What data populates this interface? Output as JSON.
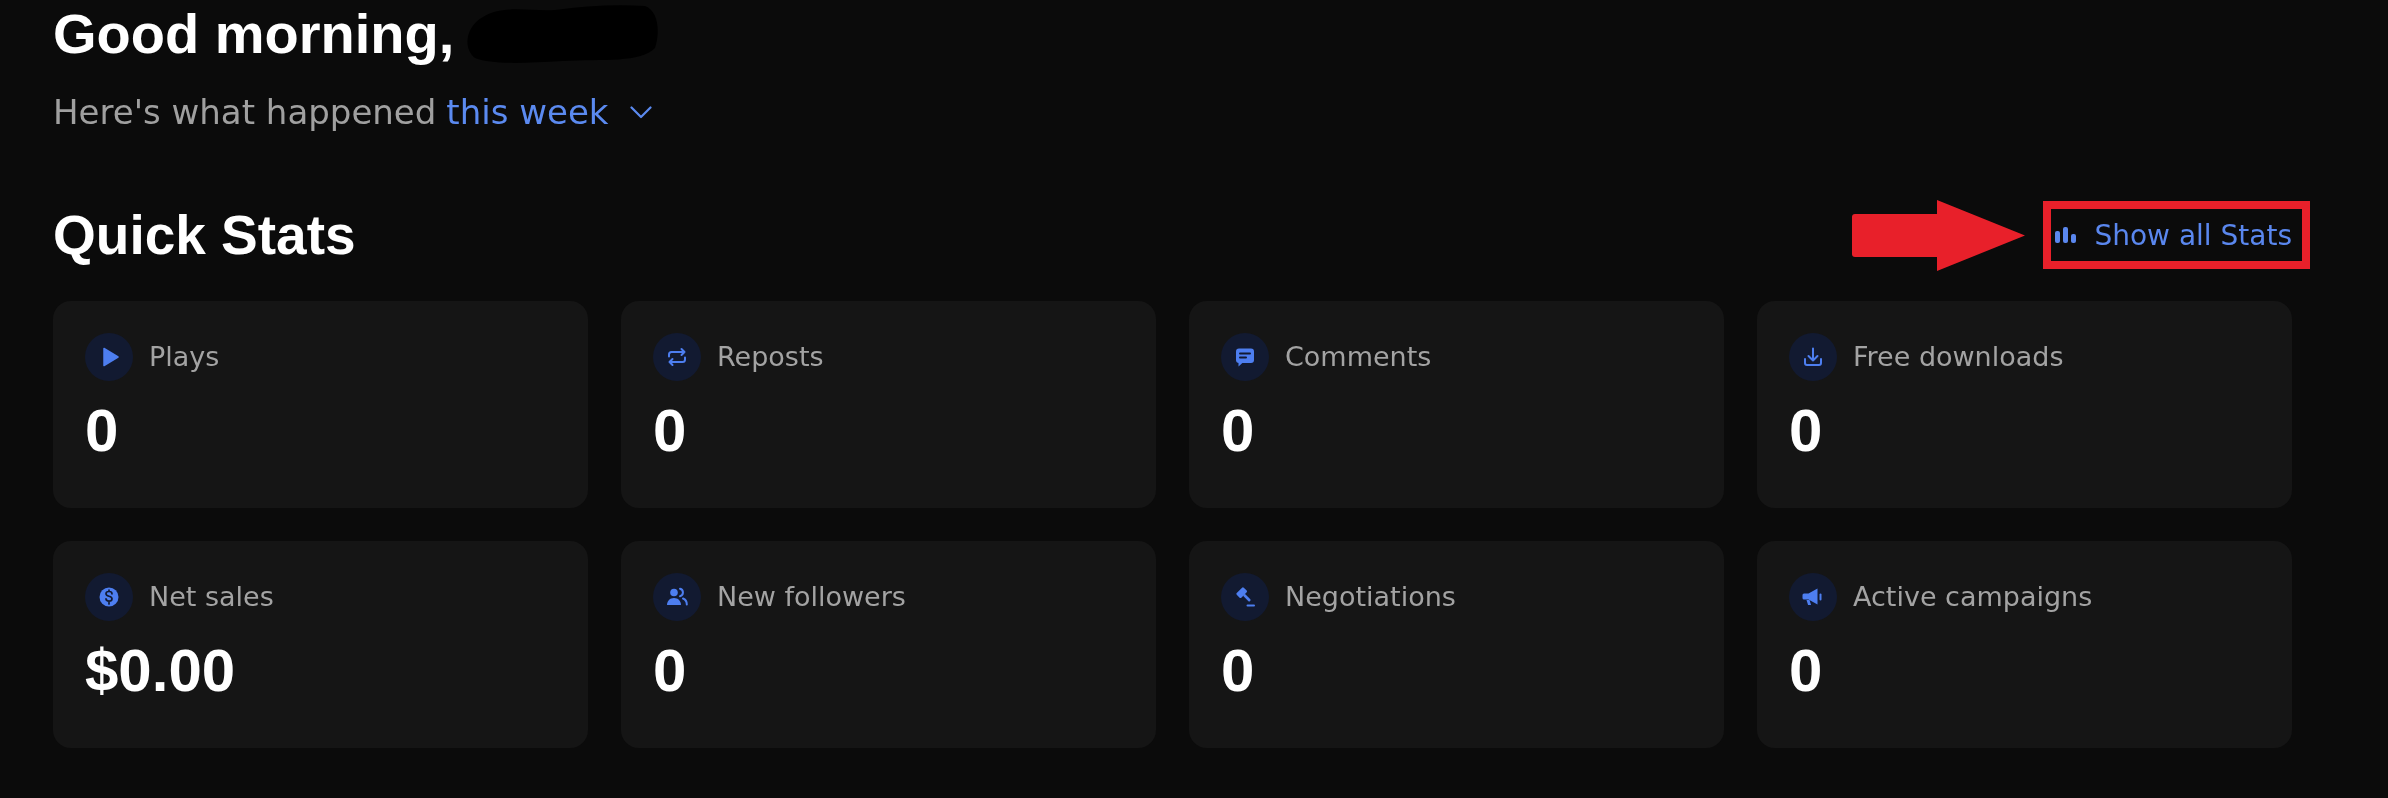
{
  "greeting": {
    "text": "Good morning,",
    "name_redacted": true
  },
  "subtitle": {
    "text": "Here's what happened",
    "period": "this week"
  },
  "quick_stats": {
    "title": "Quick Stats",
    "show_all": {
      "label": "Show all Stats",
      "highlighted": true
    },
    "cards": [
      {
        "kind": "plays",
        "label": "Plays",
        "value": "0"
      },
      {
        "kind": "reposts",
        "label": "Reposts",
        "value": "0"
      },
      {
        "kind": "comments",
        "label": "Comments",
        "value": "0"
      },
      {
        "kind": "downloads",
        "label": "Free downloads",
        "value": "0"
      },
      {
        "kind": "sales",
        "label": "Net sales",
        "value": "$0.00"
      },
      {
        "kind": "followers",
        "label": "New followers",
        "value": "0"
      },
      {
        "kind": "negotiations",
        "label": "Negotiations",
        "value": "0"
      },
      {
        "kind": "campaigns",
        "label": "Active campaigns",
        "value": "0"
      }
    ]
  }
}
